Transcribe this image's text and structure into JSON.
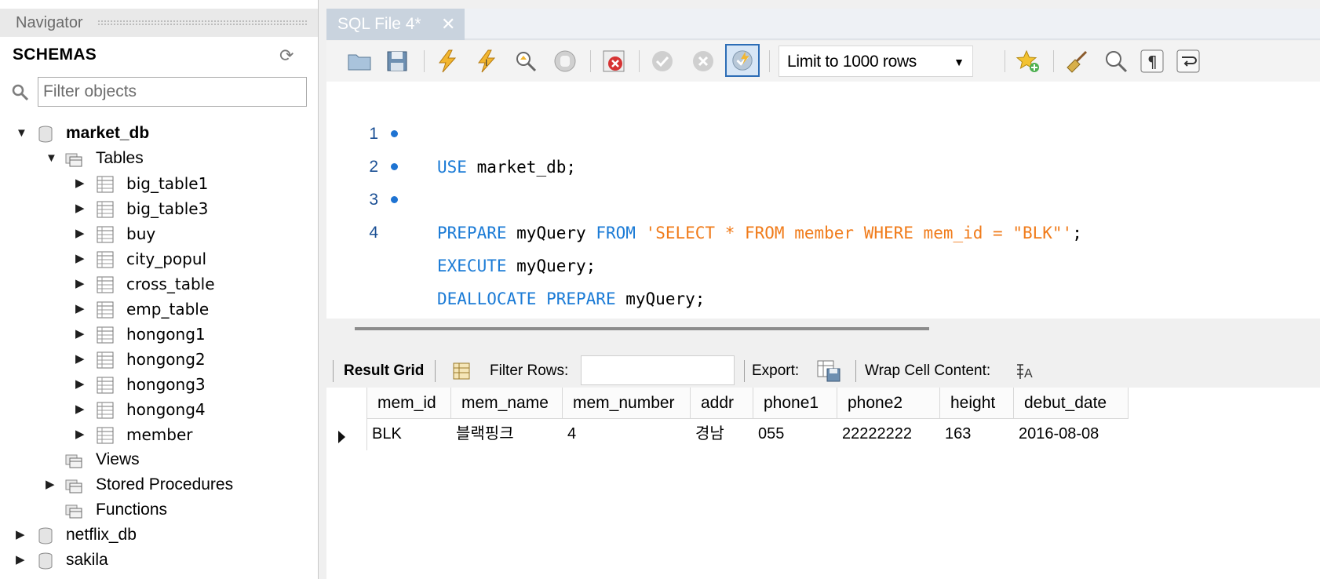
{
  "navigator": {
    "title": "Navigator",
    "schemas_label": "SCHEMAS",
    "filter_placeholder": "Filter objects",
    "market_db": "market_db",
    "tables_label": "Tables",
    "tables": [
      "big_table1",
      "big_table3",
      "buy",
      "city_popul",
      "cross_table",
      "emp_table",
      "hongong1",
      "hongong2",
      "hongong3",
      "hongong4",
      "member"
    ],
    "views_label": "Views",
    "procedures_label": "Stored Procedures",
    "functions_label": "Functions",
    "other_schemas": [
      "netflix_db",
      "sakila"
    ]
  },
  "tab": {
    "label": "SQL File 4*",
    "close": "✕"
  },
  "toolbar": {
    "limit_label": "Limit to 1000 rows"
  },
  "editor": {
    "lines": [
      {
        "num": "1",
        "kw1": "USE",
        "t1": " market_db;",
        "kw2": "",
        "t2": "",
        "str": "",
        "t3": ""
      },
      {
        "num": "2",
        "kw1": "PREPARE",
        "t1": " myQuery ",
        "kw2": "FROM",
        "t2": " ",
        "str": "'SELECT * FROM member WHERE mem_id = \"BLK\"'",
        "t3": ";"
      },
      {
        "num": "3",
        "kw1": "EXECUTE",
        "t1": " myQuery;",
        "kw2": "",
        "t2": "",
        "str": "",
        "t3": ""
      },
      {
        "num": "4",
        "kw1": "DEALLOCATE",
        "t1": " ",
        "kw2": "PREPARE",
        "t2": " myQuery;",
        "str": "",
        "t3": ""
      }
    ]
  },
  "results": {
    "result_grid_label": "Result Grid",
    "filter_rows_label": "Filter Rows:",
    "export_label": "Export:",
    "wrap_label": "Wrap Cell Content:",
    "columns": [
      "mem_id",
      "mem_name",
      "mem_number",
      "addr",
      "phone1",
      "phone2",
      "height",
      "debut_date"
    ],
    "rows": [
      [
        "BLK",
        "블랙핑크",
        "4",
        "경남",
        "055",
        "22222222",
        "163",
        "2016-08-08"
      ]
    ]
  }
}
